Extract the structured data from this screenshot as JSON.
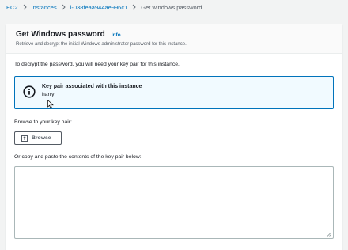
{
  "breadcrumb": {
    "items": [
      "EC2",
      "Instances",
      "i-038feaa944ae996c1"
    ],
    "current": "Get windows password"
  },
  "panel": {
    "title": "Get Windows password",
    "info_link": "Info",
    "description": "Retrieve and decrypt the initial Windows administrator password for this instance."
  },
  "content": {
    "intro": "To decrypt the password, you will need your key pair for this instance.",
    "key_pair_box": {
      "title": "Key pair associated with this instance",
      "value": "harry"
    },
    "browse_label": "Browse to your key pair:",
    "browse_button": "Browse",
    "paste_label": "Or copy and paste the contents of the key pair below:",
    "textarea_value": ""
  },
  "colors": {
    "link": "#0073bb",
    "info_border": "#0073bb",
    "info_background": "#f1faff"
  }
}
